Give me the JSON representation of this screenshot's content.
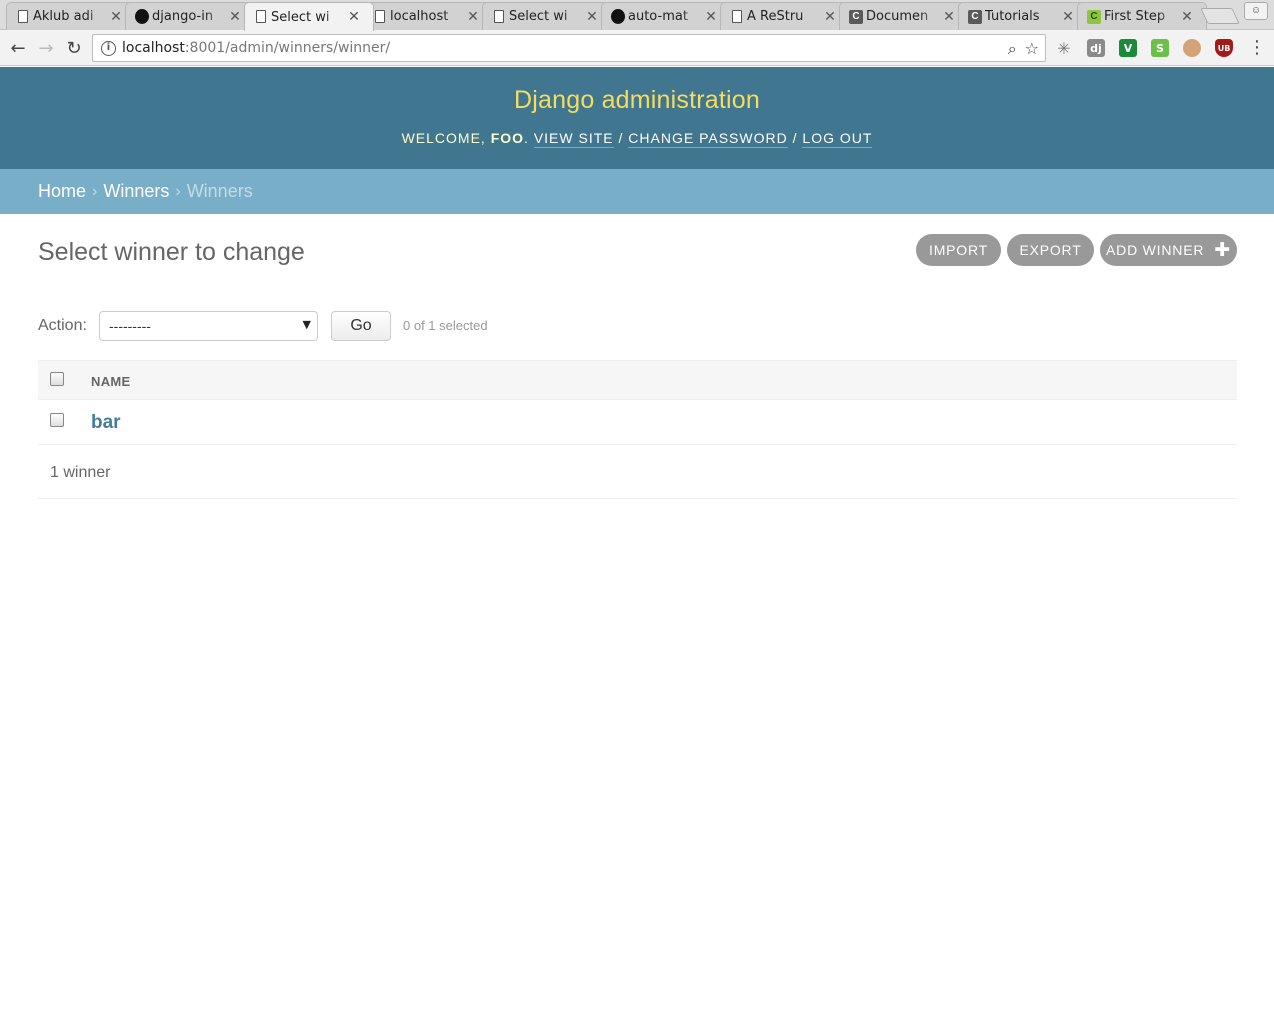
{
  "browser": {
    "tabs": [
      {
        "title": "Aklub adi",
        "favicon": "doc-icon"
      },
      {
        "title": "django-in",
        "favicon": "github-icon"
      },
      {
        "title": "Select wi",
        "favicon": "doc-icon",
        "active": true
      },
      {
        "title": "localhost",
        "favicon": "doc-icon"
      },
      {
        "title": "Select wi",
        "favicon": "doc-icon"
      },
      {
        "title": "auto-mat",
        "favicon": "github-icon"
      },
      {
        "title": "A ReStru",
        "favicon": "doc-icon"
      },
      {
        "title": "Documen",
        "favicon": "c-icon"
      },
      {
        "title": "Tutorials",
        "favicon": "c-icon"
      },
      {
        "title": "First Step",
        "favicon": "c-green-icon"
      }
    ],
    "url_host": "localhost",
    "url_path": ":8001/admin/winners/winner/",
    "extensions": [
      {
        "name": "spark-icon",
        "label": "✳",
        "color": "#9a9a9a"
      },
      {
        "name": "django-icon",
        "label": "dj",
        "color": "#8a8a8a"
      },
      {
        "name": "vim-icon",
        "label": "V",
        "color": "#1b8a3a"
      },
      {
        "name": "evernote-icon",
        "label": "S",
        "color": "#6cc04a"
      },
      {
        "name": "color-icon",
        "label": "",
        "color": "#d4a37a"
      },
      {
        "name": "ublock-icon",
        "label": "UB",
        "color": "#a31a1a"
      }
    ]
  },
  "admin": {
    "site_title": "Django administration",
    "welcome": "Welcome,",
    "username": "foo",
    "view_site": "View site",
    "change_password": "Change password",
    "log_out": "Log out",
    "breadcrumbs": {
      "home": "Home",
      "app": "Winners",
      "current": "Winners"
    },
    "page_title": "Select winner to change",
    "object_tools": {
      "import": "Import",
      "export": "Export",
      "add": "Add winner"
    },
    "actions": {
      "label": "Action:",
      "selected": "---------",
      "go": "Go",
      "counter": "0 of 1 selected"
    },
    "table": {
      "columns": [
        "Name"
      ],
      "rows": [
        {
          "name": "bar"
        }
      ]
    },
    "paginator": "1 winner",
    "colors": {
      "header": "#417690",
      "breadcrumbs": "#79aec8",
      "title": "#f5dd5d",
      "link": "#447e9b"
    }
  }
}
